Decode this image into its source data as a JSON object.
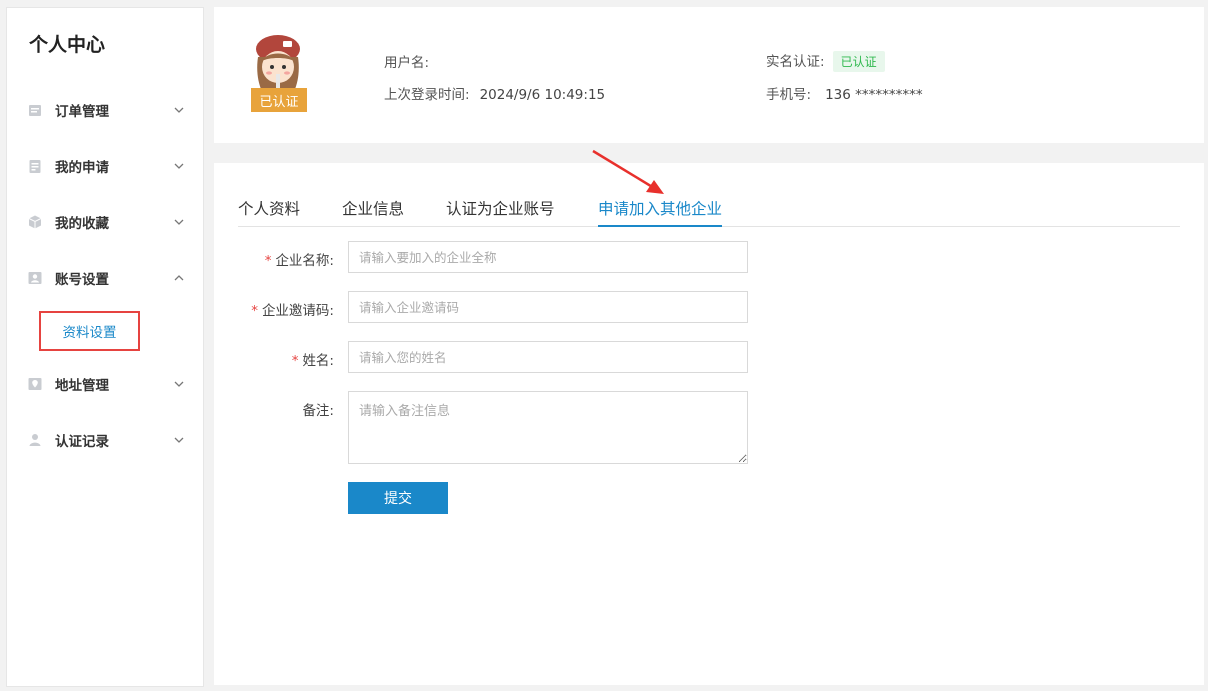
{
  "sidebar": {
    "title": "个人中心",
    "items": [
      {
        "label": "订单管理",
        "icon": "order-icon"
      },
      {
        "label": "我的申请",
        "icon": "application-icon"
      },
      {
        "label": "我的收藏",
        "icon": "favorite-icon"
      },
      {
        "label": "账号设置",
        "icon": "account-icon"
      },
      {
        "label": "地址管理",
        "icon": "address-icon"
      },
      {
        "label": "认证记录",
        "icon": "cert-record-icon"
      }
    ],
    "submenu": {
      "label": "资料设置"
    }
  },
  "profile": {
    "verified_tag": "已认证",
    "username_label": "用户名:",
    "username_value": "",
    "last_login_label": "上次登录时间:",
    "last_login_value": "2024/9/6 10:49:15",
    "realname_label": "实名认证:",
    "realname_status": "已认证",
    "phone_label": "手机号:",
    "phone_value": "136 **********"
  },
  "tabs": [
    {
      "label": "个人资料",
      "active": false
    },
    {
      "label": "企业信息",
      "active": false
    },
    {
      "label": "认证为企业账号",
      "active": false
    },
    {
      "label": "申请加入其他企业",
      "active": true
    }
  ],
  "form": {
    "company_name": {
      "label": "企业名称:",
      "required_mark": "*",
      "placeholder": "请输入要加入的企业全称"
    },
    "invite_code": {
      "label": "企业邀请码:",
      "required_mark": "*",
      "placeholder": "请输入企业邀请码"
    },
    "name": {
      "label": "姓名:",
      "required_mark": "*",
      "placeholder": "请输入您的姓名"
    },
    "remark": {
      "label": "备注:",
      "placeholder": "请输入备注信息"
    },
    "submit_label": "提交"
  },
  "colors": {
    "accent": "#1a88c9",
    "highlight_border": "#e64340",
    "verified_tag": "#e8a33b",
    "verified_green": "#2fb94e"
  }
}
